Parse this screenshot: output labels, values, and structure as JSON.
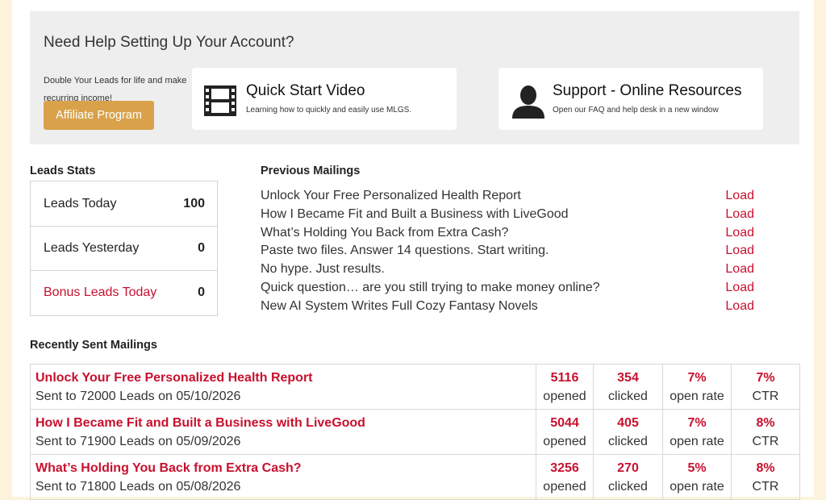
{
  "help": {
    "title": "Need Help Setting Up Your Account?",
    "affiliate_text": "Double Your Leads for life and make recurring income!",
    "affiliate_button": "Affiliate Program",
    "quick_start": {
      "title": "Quick Start Video",
      "subtitle": "Learning how to quickly and easily use MLGS.",
      "icon": "film-icon"
    },
    "support": {
      "title": "Support - Online Resources",
      "subtitle": "Open our FAQ and help desk in a new window",
      "icon": "user-icon"
    }
  },
  "leads_stats": {
    "title": "Leads Stats",
    "rows": [
      {
        "label": "Leads Today",
        "value": "100"
      },
      {
        "label": "Leads Yesterday",
        "value": "0"
      },
      {
        "label": "Bonus Leads Today",
        "value": "0"
      }
    ]
  },
  "previous_mailings": {
    "title": "Previous Mailings",
    "load_label": "Load",
    "items": [
      "Unlock Your Free Personalized Health Report",
      "How I Became Fit and Built a Business with LiveGood",
      "What’s Holding You Back from Extra Cash?",
      "Paste two files. Answer 14 questions. Start writing.",
      "No hype. Just results.",
      "Quick question… are you still trying to make money online?",
      "New AI System Writes Full Cozy Fantasy Novels"
    ]
  },
  "recent": {
    "title": "Recently Sent Mailings",
    "labels": {
      "opened": "opened",
      "clicked": "clicked",
      "open_rate": "open rate",
      "ctr": "CTR"
    },
    "rows": [
      {
        "subject": "Unlock Your Free Personalized Health Report",
        "meta": "Sent to 72000 Leads on 05/10/2026",
        "opened": "5116",
        "clicked": "354",
        "open_rate": "7%",
        "ctr": "7%"
      },
      {
        "subject": "How I Became Fit and Built a Business with LiveGood",
        "meta": "Sent to 71900 Leads on 05/09/2026",
        "opened": "5044",
        "clicked": "405",
        "open_rate": "7%",
        "ctr": "8%"
      },
      {
        "subject": "What’s Holding You Back from Extra Cash?",
        "meta": "Sent to 71800 Leads on 05/08/2026",
        "opened": "3256",
        "clicked": "270",
        "open_rate": "5%",
        "ctr": "8%"
      }
    ]
  },
  "colors": {
    "accent_red": "#c8102e",
    "affiliate_button": "#d9a24a",
    "page_bg": "#fdf3dd"
  }
}
